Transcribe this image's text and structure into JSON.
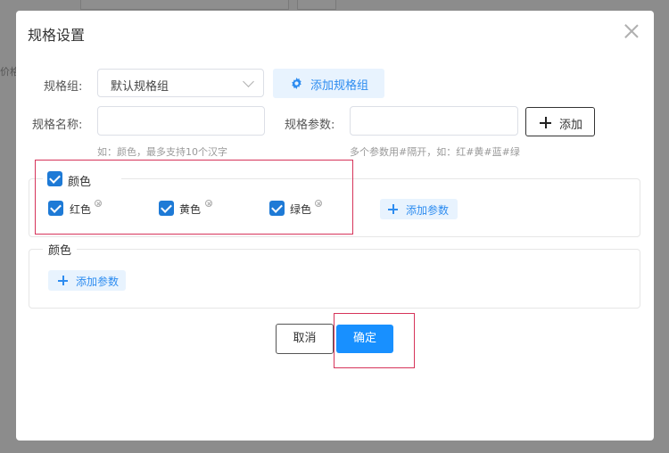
{
  "background": {
    "side_label": "价格"
  },
  "dialog": {
    "title": "规格设置",
    "spec_group_label": "规格组:",
    "spec_group_value": "默认规格组",
    "add_group_button": "添加规格组",
    "spec_name_label": "规格名称:",
    "spec_name_value": "",
    "spec_name_hint": "如：颜色，最多支持10个汉字",
    "spec_param_label": "规格参数:",
    "spec_param_value": "",
    "spec_param_hint": "多个参数用#隔开，如：红#黄#蓝#绿",
    "add_button": "添加",
    "groups": [
      {
        "name": "颜色",
        "checked": true,
        "options": [
          {
            "label": "红色",
            "checked": true
          },
          {
            "label": "黄色",
            "checked": true
          },
          {
            "label": "绿色",
            "checked": true
          }
        ],
        "add_param_button": "添加参数"
      },
      {
        "name": "颜色",
        "options": [],
        "add_param_button": "添加参数"
      }
    ],
    "cancel_button": "取消",
    "confirm_button": "确定"
  },
  "colors": {
    "primary": "#1890ff",
    "checkbox": "#1e7ad6",
    "light_button_bg": "#e8f3fe",
    "light_button_text": "#2d8cf0",
    "highlight_annotation": "#d6345a",
    "overlay": "#8c8c8c"
  },
  "icons": {
    "add_group": "gear-icon",
    "add": "plus-icon",
    "close": "close-icon",
    "remove_option": "circle-x-icon",
    "select": "chevron-down-icon"
  }
}
